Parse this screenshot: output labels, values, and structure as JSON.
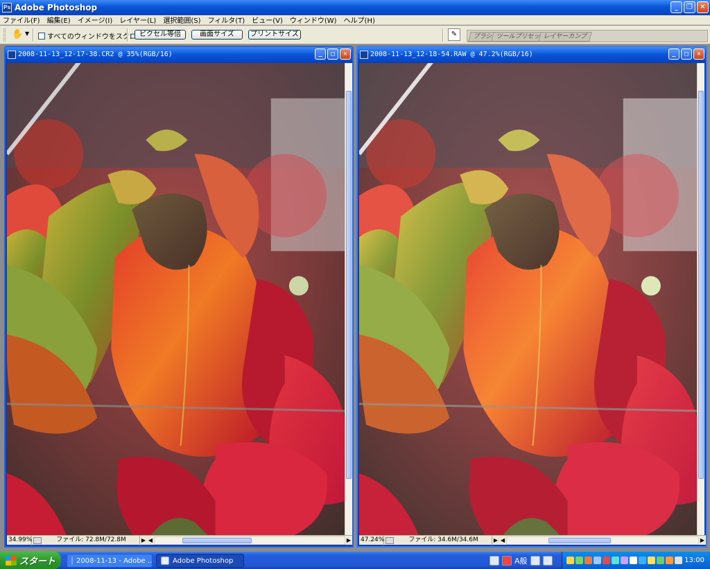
{
  "app": {
    "title": "Adobe Photoshop"
  },
  "menu": [
    "ファイル(F)",
    "編集(E)",
    "イメージ(I)",
    "レイヤー(L)",
    "選択範囲(S)",
    "フィルタ(T)",
    "ビュー(V)",
    "ウィンドウ(W)",
    "ヘルプ(H)"
  ],
  "options": {
    "scroll_all_label": "すべてのウィンドウをスクロール",
    "actual_pixels": "ピクセル等倍",
    "fit_screen": "画面サイズ",
    "print_size": "プリントサイズ"
  },
  "palette_well": {
    "tabs": [
      "ブラシ",
      "ツールプリセット",
      "レイヤーカンプ"
    ]
  },
  "documents": [
    {
      "title": "2008-11-13_12-17-38.CR2 @ 35%(RGB/16)",
      "zoom": "34.99%",
      "file_info": "ファイル: 72.8M/72.8M"
    },
    {
      "title": "2008-11-13_12-18-54.RAW @ 47.2%(RGB/16)",
      "zoom": "47.24%",
      "file_info": "ファイル: 34.6M/34.6M"
    }
  ],
  "taskbar": {
    "start_label": "スタート",
    "tasks": [
      "2008-11-13 - Adobe ...",
      "Adobe Photoshop"
    ],
    "ime": "A般",
    "clock": "13:00"
  }
}
